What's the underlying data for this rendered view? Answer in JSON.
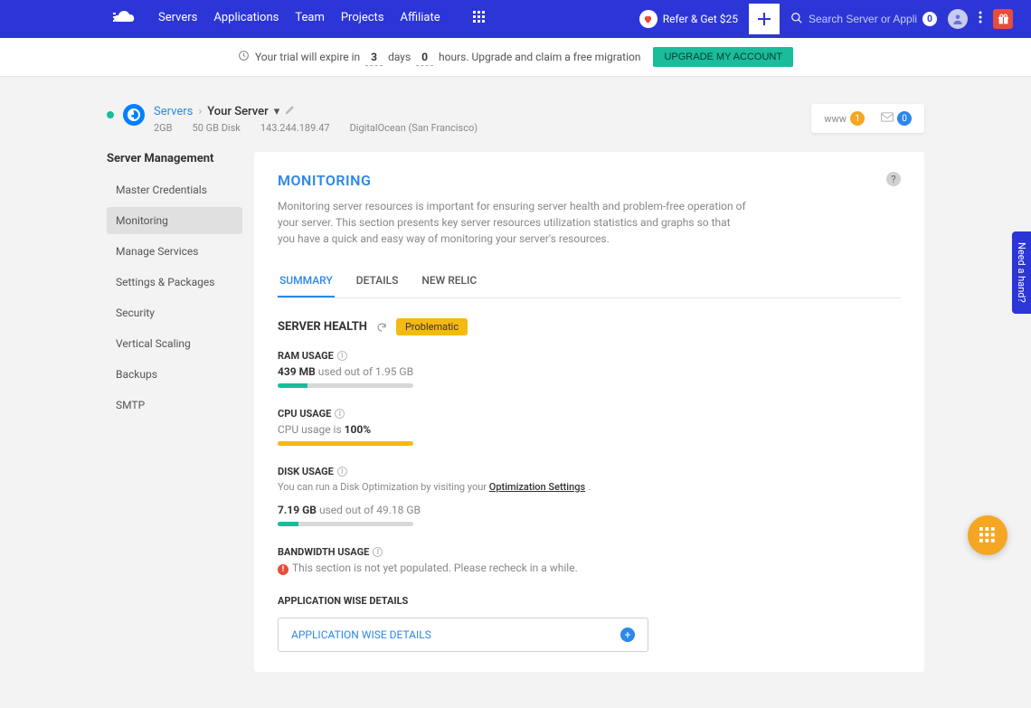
{
  "topnav": {
    "items": [
      "Servers",
      "Applications",
      "Team",
      "Projects",
      "Affiliate"
    ],
    "refer": "Refer & Get $25",
    "search_placeholder": "Search Server or Application",
    "search_count": "0"
  },
  "trial": {
    "prefix": "Your trial will expire in",
    "days_num": "3",
    "days_lbl": "days",
    "hours_num": "0",
    "hours_lbl": "hours. Upgrade and claim a free migration",
    "button": "UPGRADE MY ACCOUNT"
  },
  "breadcrumb": {
    "root": "Servers",
    "current": "Your Server"
  },
  "server_meta": {
    "ram": "2GB",
    "disk": "50 GB Disk",
    "ip": "143.244.189.47",
    "provider": "DigitalOcean (San Francisco)"
  },
  "notify": {
    "www_label": "www",
    "www_count": "1",
    "mail_count": "0"
  },
  "sidebar": {
    "title": "Server Management",
    "items": [
      "Master Credentials",
      "Monitoring",
      "Manage Services",
      "Settings & Packages",
      "Security",
      "Vertical Scaling",
      "Backups",
      "SMTP"
    ],
    "active": 1
  },
  "panel": {
    "title": "MONITORING",
    "desc": "Monitoring server resources is important for ensuring server health and problem-free operation of your server. This section presents key server resources utilization statistics and graphs so that you have a quick and easy way of monitoring your server's resources."
  },
  "tabs": {
    "items": [
      "SUMMARY",
      "DETAILS",
      "NEW RELIC"
    ],
    "active": 0
  },
  "health": {
    "label": "SERVER HEALTH",
    "badge": "Problematic"
  },
  "ram": {
    "title": "RAM USAGE",
    "used": "439 MB",
    "suffix": " used out of 1.95 GB",
    "percent": 22
  },
  "cpu": {
    "title": "CPU USAGE",
    "prefix": "CPU usage is ",
    "value": "100%",
    "percent": 100
  },
  "disk": {
    "title": "DISK USAGE",
    "hint_prefix": "You can run a Disk Optimization by visiting your  ",
    "hint_link": "Optimization Settings",
    "used": "7.19 GB",
    "suffix": " used out of 49.18 GB",
    "percent": 15
  },
  "bandwidth": {
    "title": "BANDWIDTH USAGE",
    "msg": "This section is not yet populated. Please recheck in a while."
  },
  "appwise": {
    "title": "APPLICATION WISE DETAILS",
    "row": "APPLICATION WISE DETAILS"
  },
  "help_tab": "Need a hand?",
  "chart_data": [
    {
      "type": "bar",
      "title": "RAM USAGE",
      "categories": [
        "used"
      ],
      "values": [
        439
      ],
      "ylim": [
        0,
        1996.8
      ],
      "ylabel": "MB"
    },
    {
      "type": "bar",
      "title": "CPU USAGE",
      "categories": [
        "used"
      ],
      "values": [
        100
      ],
      "ylim": [
        0,
        100
      ],
      "ylabel": "%"
    },
    {
      "type": "bar",
      "title": "DISK USAGE",
      "categories": [
        "used"
      ],
      "values": [
        7.19
      ],
      "ylim": [
        0,
        49.18
      ],
      "ylabel": "GB"
    }
  ]
}
